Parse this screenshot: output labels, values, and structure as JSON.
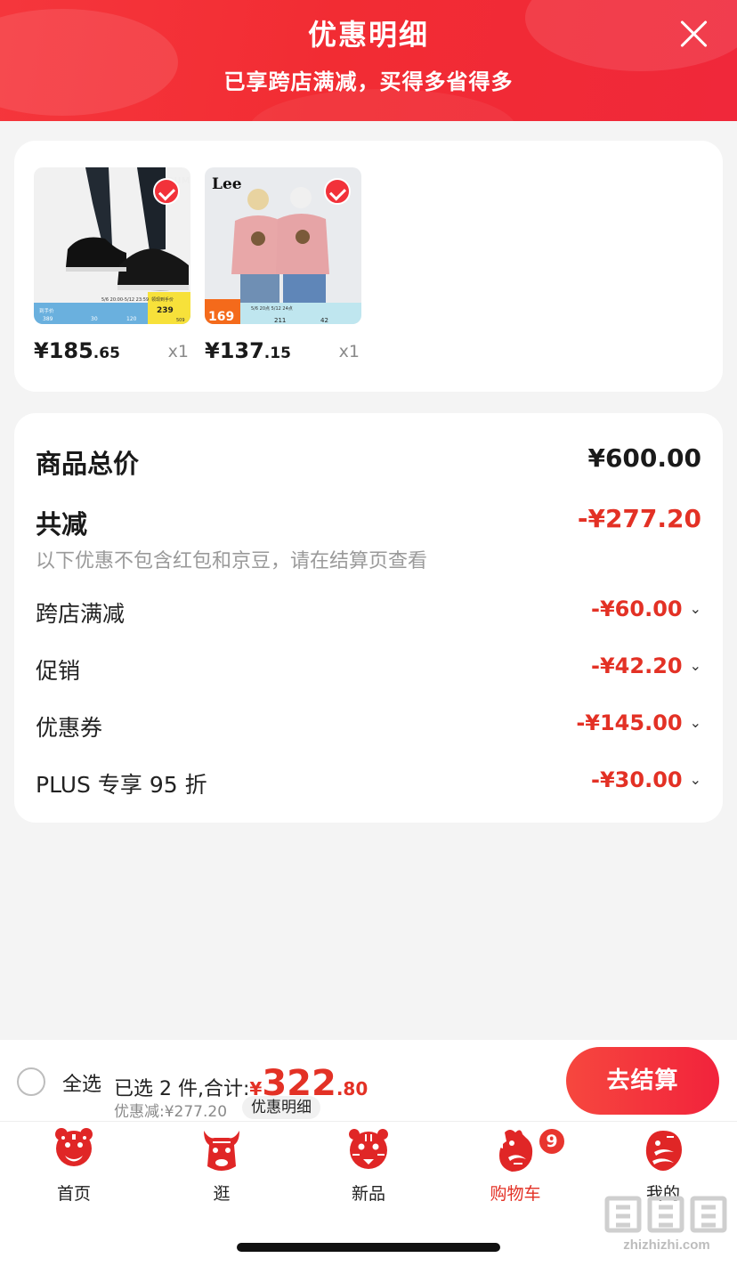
{
  "header": {
    "title": "优惠明细",
    "subtitle": "已享跨店满减，买得多省得多"
  },
  "products": [
    {
      "price_int": "¥185",
      "price_dec": ".65",
      "qty": "x1",
      "image": "black-sneakers-photo",
      "thumb_band": {
        "cols": [
          "389",
          "30",
          "120"
        ],
        "promo": "239",
        "date": "5/6 20:00-5/12 23:59",
        "badge_top": "领现到手价",
        "tail": "509"
      }
    },
    {
      "price_int": "¥137",
      "price_dec": ".15",
      "qty": "x1",
      "image": "lee-pink-tshirt-couple-photo",
      "brand": "Lee",
      "thumb_band": {
        "price": "169",
        "cols": [
          "211",
          "42"
        ],
        "date": "5/6 20点 5/12 24点"
      }
    }
  ],
  "summary": {
    "total_label": "商品总价",
    "total_value": "¥600.00",
    "discount_label": "共减",
    "discount_value": "-¥277.20",
    "hint": "以下优惠不包含红包和京豆，请在结算页查看",
    "items": [
      {
        "label": "跨店满减",
        "value": "-¥60.00"
      },
      {
        "label": "促销",
        "value": "-¥42.20"
      },
      {
        "label": "优惠券",
        "value": "-¥145.00"
      },
      {
        "label": "PLUS 专享 95 折",
        "value": "-¥30.00"
      }
    ]
  },
  "bottom_bar": {
    "select_all": "全选",
    "selected_prefix": "已选 2 件,合计:",
    "total_currency": "¥",
    "total_int": "322",
    "total_dec": ".80",
    "discount_line": "优惠减:¥277.20",
    "detail_pill": "优惠明细",
    "checkout": "去结算"
  },
  "tabs": [
    {
      "label": "首页",
      "icon": "paper-cut-rat-icon"
    },
    {
      "label": "逛",
      "icon": "paper-cut-ox-icon"
    },
    {
      "label": "新品",
      "icon": "paper-cut-tiger-icon"
    },
    {
      "label": "购物车",
      "icon": "paper-cut-rooster-icon",
      "active": true,
      "badge": "9"
    },
    {
      "label": "我的",
      "icon": "paper-cut-dragon-icon"
    }
  ],
  "watermark": {
    "text": "zhizhizhi.com",
    "glyphs": "值值值"
  },
  "colors": {
    "accent": "#e33125",
    "header_red": "#f2323a",
    "checkout_red": "#f2233c"
  }
}
